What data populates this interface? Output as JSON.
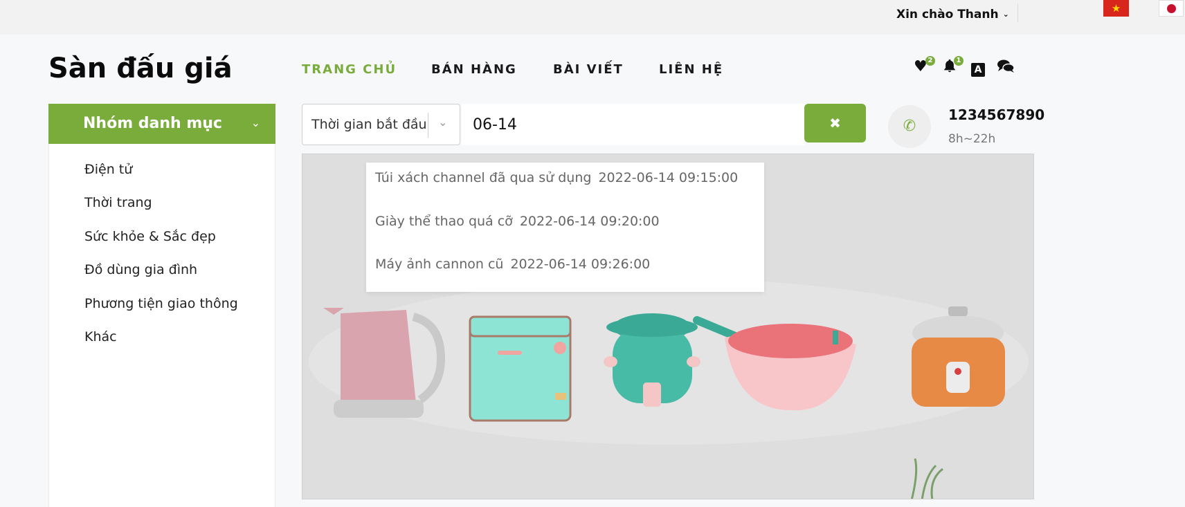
{
  "topbar": {
    "greeting": "Xin chào Thanh",
    "chevron": "⌄",
    "flags": [
      "vietnam-flag",
      "japan-flag"
    ]
  },
  "header": {
    "logo": "Sàn đấu giá",
    "nav": [
      "TRANG CHỦ",
      "BÁN HÀNG",
      "BÀI VIẾT",
      "LIÊN HỆ"
    ],
    "active_nav": "TRANG CHỦ",
    "wishlist_count": "2",
    "notification_count": "1"
  },
  "sidebar": {
    "title": "Nhóm danh mục",
    "items": [
      "Điện tử",
      "Thời trang",
      "Sức khỏe & Sắc đẹp",
      "Đồ dùng gia đình",
      "Phương tiện giao thông",
      "Khác"
    ]
  },
  "search": {
    "filter_value": "Thời gian bắt đầu",
    "query": "06-14",
    "clear_label": "✖"
  },
  "contact": {
    "phone": "1234567890",
    "hours": "8h~22h"
  },
  "suggestions": [
    {
      "name": "Túi xách channel đã qua sử dụng",
      "time": "2022-06-14 09:15:00"
    },
    {
      "name": "Giày thể thao quá cỡ",
      "time": "2022-06-14 09:20:00"
    },
    {
      "name": "Máy ảnh cannon cũ",
      "time": "2022-06-14 09:26:00"
    }
  ],
  "colors": {
    "accent": "#7aac3c",
    "topbar": "#f2f2f2",
    "page": "#f7f8fa"
  }
}
